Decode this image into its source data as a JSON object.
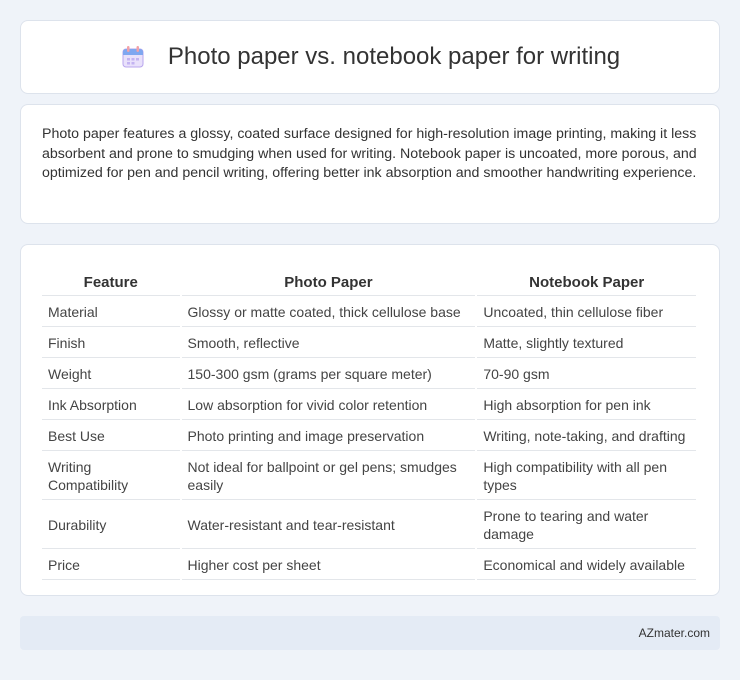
{
  "header": {
    "icon": "calendar-icon",
    "title": "Photo paper vs. notebook paper for writing"
  },
  "intro": {
    "text": "Photo paper features a glossy, coated surface designed for high-resolution image printing, making it less absorbent and prone to smudging when used for writing. Notebook paper is uncoated, more porous, and optimized for pen and pencil writing, offering better ink absorption and smoother handwriting experience."
  },
  "table": {
    "headers": [
      "Feature",
      "Photo Paper",
      "Notebook Paper"
    ],
    "rows": [
      [
        "Material",
        "Glossy or matte coated, thick cellulose base",
        "Uncoated, thin cellulose fiber"
      ],
      [
        "Finish",
        "Smooth, reflective",
        "Matte, slightly textured"
      ],
      [
        "Weight",
        "150-300 gsm (grams per square meter)",
        "70-90 gsm"
      ],
      [
        "Ink Absorption",
        "Low absorption for vivid color retention",
        "High absorption for pen ink"
      ],
      [
        "Best Use",
        "Photo printing and image preservation",
        "Writing, note-taking, and drafting"
      ],
      [
        "Writing Compatibility",
        "Not ideal for ballpoint or gel pens; smudges easily",
        "High compatibility with all pen types"
      ],
      [
        "Durability",
        "Water-resistant and tear-resistant",
        "Prone to tearing and water damage"
      ],
      [
        "Price",
        "Higher cost per sheet",
        "Economical and widely available"
      ]
    ]
  },
  "footer": {
    "brand": "AZmater.com"
  }
}
